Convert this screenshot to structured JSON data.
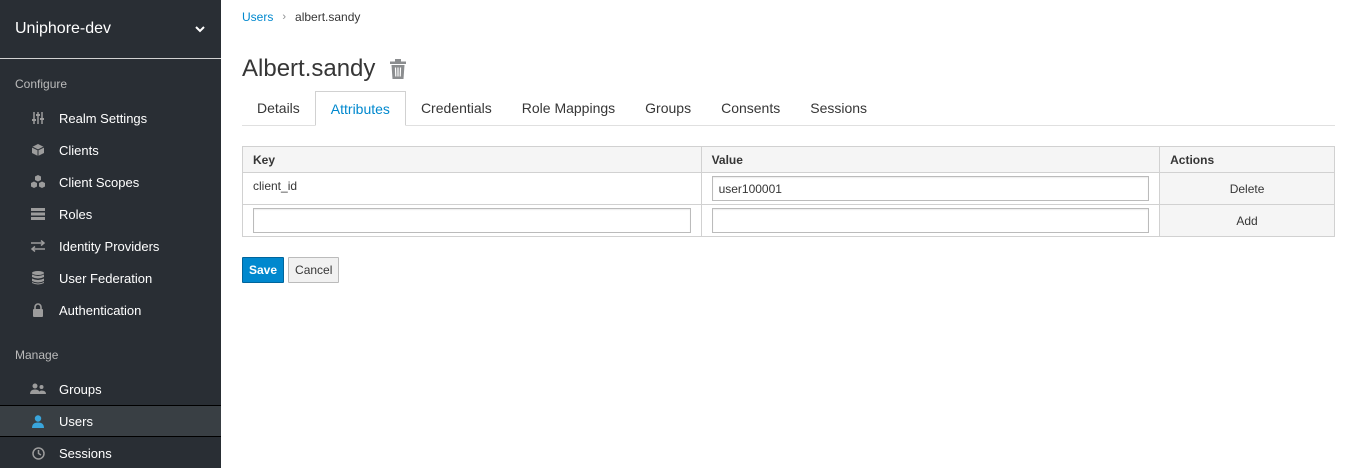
{
  "sidebar": {
    "realm": "Uniphore-dev",
    "configure_title": "Configure",
    "configure_items": [
      {
        "label": "Realm Settings",
        "icon": "sliders-icon"
      },
      {
        "label": "Clients",
        "icon": "cube-icon"
      },
      {
        "label": "Client Scopes",
        "icon": "cubes-icon"
      },
      {
        "label": "Roles",
        "icon": "list-icon"
      },
      {
        "label": "Identity Providers",
        "icon": "exchange-icon"
      },
      {
        "label": "User Federation",
        "icon": "database-icon"
      },
      {
        "label": "Authentication",
        "icon": "lock-icon"
      }
    ],
    "manage_title": "Manage",
    "manage_items": [
      {
        "label": "Groups",
        "icon": "users-icon"
      },
      {
        "label": "Users",
        "icon": "user-icon",
        "active": true
      },
      {
        "label": "Sessions",
        "icon": "clock-icon"
      }
    ]
  },
  "breadcrumb": {
    "parent": "Users",
    "current": "albert.sandy"
  },
  "page": {
    "title": "Albert.sandy"
  },
  "tabs": [
    "Details",
    "Attributes",
    "Credentials",
    "Role Mappings",
    "Groups",
    "Consents",
    "Sessions"
  ],
  "active_tab": "Attributes",
  "table": {
    "headers": {
      "key": "Key",
      "value": "Value",
      "actions": "Actions"
    },
    "rows": [
      {
        "key": "client_id",
        "value": "user100001",
        "action": "Delete"
      }
    ],
    "new_row": {
      "key": "",
      "value": "",
      "action": "Add"
    }
  },
  "buttons": {
    "save": "Save",
    "cancel": "Cancel"
  },
  "colors": {
    "sidebar_bg": "#292e34",
    "accent": "#0088ce",
    "active_item_bg": "#393f44"
  }
}
